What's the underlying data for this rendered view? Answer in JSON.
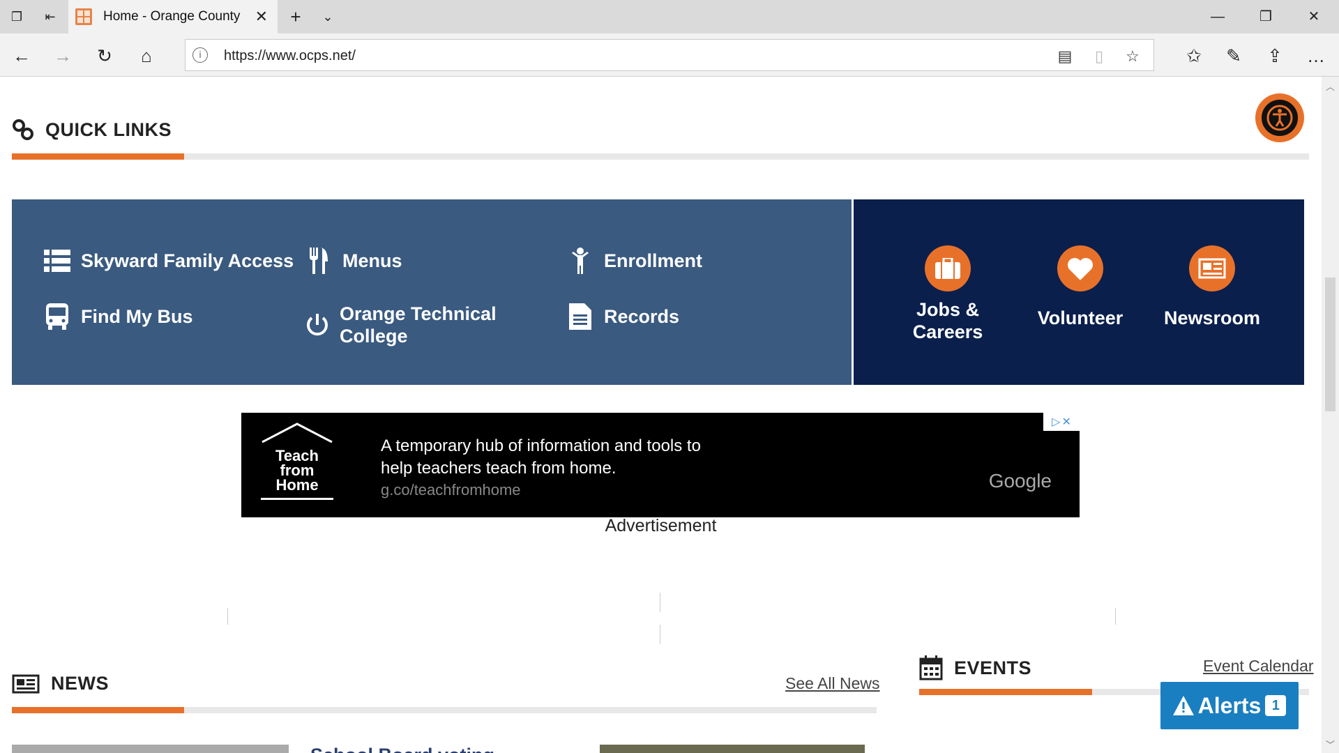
{
  "browser": {
    "tab_title": "Home - Orange County",
    "url": "https://www.ocps.net/"
  },
  "quick_links": {
    "title": "QUICK LINKS",
    "items": [
      {
        "label": "Skyward Family Access",
        "icon": "list-icon"
      },
      {
        "label": "Menus",
        "icon": "utensils-icon"
      },
      {
        "label": "Enrollment",
        "icon": "child-icon"
      },
      {
        "label": "Find My Bus",
        "icon": "bus-icon"
      },
      {
        "label": "Orange Technical College",
        "icon": "power-icon"
      },
      {
        "label": "Records",
        "icon": "document-icon"
      }
    ],
    "featured": [
      {
        "label": "Jobs & Careers",
        "icon": "briefcase-icon"
      },
      {
        "label": "Volunteer",
        "icon": "heart-icon"
      },
      {
        "label": "Newsroom",
        "icon": "newspaper-icon"
      }
    ]
  },
  "ad": {
    "logo_text": "Teach from Home",
    "line1": "A temporary hub of information and tools to",
    "line2": "help teachers teach from home.",
    "url": "g.co/teachfromhome",
    "brand": "Google",
    "caption": "Advertisement"
  },
  "news": {
    "title": "NEWS",
    "see_all": "See All News",
    "headline_partial": "School Board voting"
  },
  "events": {
    "title": "EVENTS",
    "calendar_link": "Event Calendar"
  },
  "alerts": {
    "label": "Alerts",
    "count": "1"
  },
  "colors": {
    "accent": "#e8712a",
    "quick_links_bg": "#3a5a80",
    "featured_bg": "#0a1f4c",
    "alerts_bg": "#1a7fc1"
  }
}
